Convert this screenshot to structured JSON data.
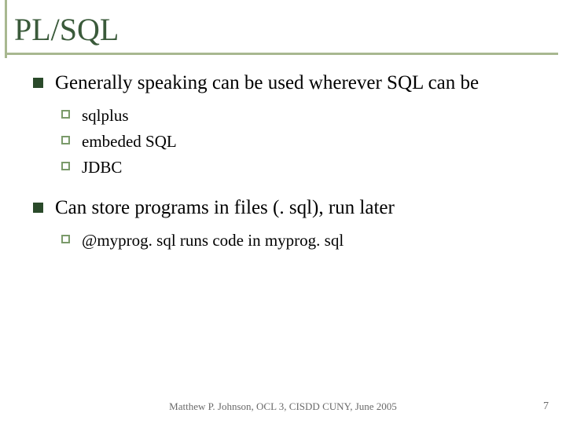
{
  "title": "PL/SQL",
  "bullets": [
    {
      "text": "Generally speaking can be used wherever SQL can be",
      "sub": [
        "sqlplus",
        "embeded SQL",
        "JDBC"
      ]
    },
    {
      "text": "Can store programs in files (. sql), run later",
      "sub": [
        "@myprog. sql runs code in myprog. sql"
      ]
    }
  ],
  "footer": "Matthew P. Johnson, OCL 3, CISDD CUNY, June 2005",
  "page_number": "7"
}
